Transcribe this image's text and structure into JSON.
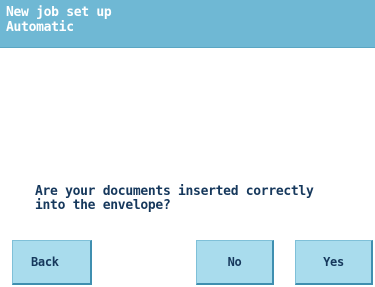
{
  "header": {
    "title": "New job set up",
    "subtitle": "Automatic"
  },
  "message": {
    "text": "Are your documents inserted correctly\ninto the envelope?"
  },
  "buttons": {
    "back_label": "Back",
    "no_label": "No",
    "yes_label": "Yes"
  },
  "colors": {
    "header_bg": "#6fb8d4",
    "button_bg": "#a9dced",
    "text_dark": "#16385c"
  }
}
